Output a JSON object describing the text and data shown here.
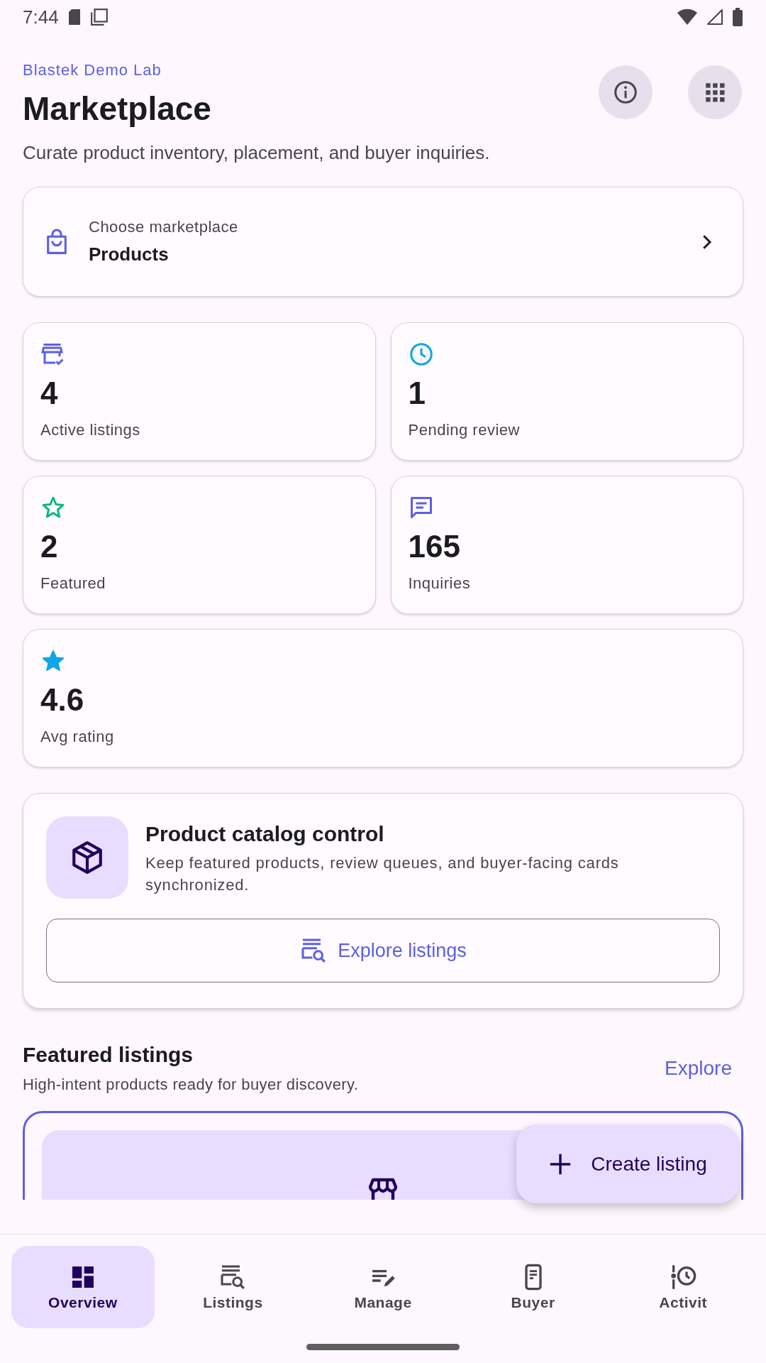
{
  "status_bar": {
    "time": "7:44"
  },
  "header": {
    "brand": "Blastek Demo Lab",
    "title": "Marketplace",
    "subtitle": "Curate product inventory, placement, and buyer inquiries."
  },
  "marketplace_picker": {
    "label": "Choose marketplace",
    "value": "Products"
  },
  "stats": [
    {
      "value": "4",
      "label": "Active listings",
      "color": "#5d5fe6"
    },
    {
      "value": "1",
      "label": "Pending review",
      "color": "#0ea5e9"
    },
    {
      "value": "2",
      "label": "Featured",
      "color": "#10b981"
    },
    {
      "value": "165",
      "label": "Inquiries",
      "color": "#5d5fe6"
    },
    {
      "value": "4.6",
      "label": "Avg rating",
      "color": "#0ea5e9"
    }
  ],
  "catalog_card": {
    "title": "Product catalog control",
    "description": "Keep featured products, review queues, and buyer-facing cards synchronized.",
    "button": "Explore listings"
  },
  "featured": {
    "title": "Featured listings",
    "subtitle": "High-intent products ready for buyer discovery.",
    "action": "Explore"
  },
  "fab": {
    "label": "Create listing"
  },
  "nav": [
    {
      "label": "Overview",
      "selected": true
    },
    {
      "label": "Listings",
      "selected": false
    },
    {
      "label": "Manage",
      "selected": false
    },
    {
      "label": "Buyer",
      "selected": false
    },
    {
      "label": "Activit",
      "selected": false
    }
  ]
}
